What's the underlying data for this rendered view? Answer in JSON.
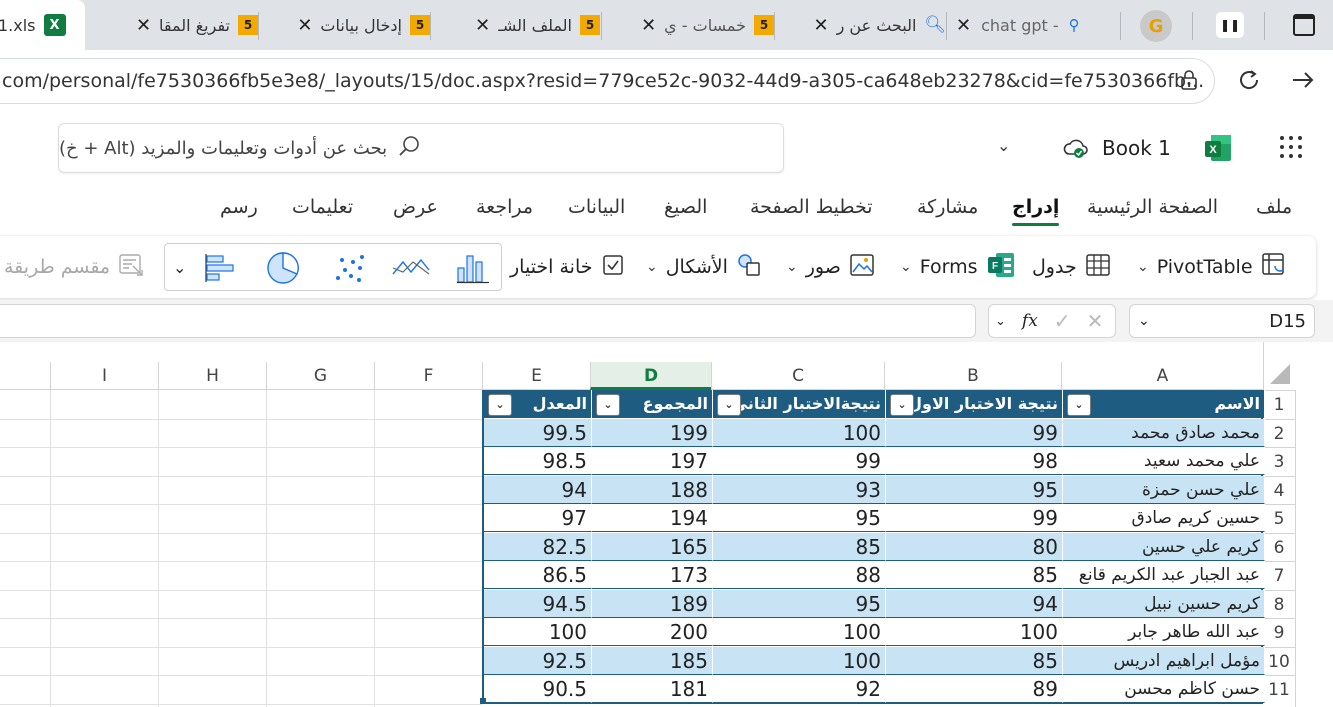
{
  "tabs": [
    {
      "title": "1.xls",
      "icon": "excel-icon"
    },
    {
      "title": "تفريغ المقا",
      "icon": "badge-5-icon"
    },
    {
      "title": "إدخال بيانات",
      "icon": "badge-5-icon"
    },
    {
      "title": "الملف الشـ",
      "icon": "badge-5-icon"
    },
    {
      "title": "خمسات - ي",
      "icon": "badge-5-icon"
    },
    {
      "title": "البحث عن ر",
      "icon": "search-icon"
    },
    {
      "title": "chat gpt -",
      "icon": "chatgpt-icon"
    }
  ],
  "badge_text": "5",
  "address": {
    "url": "com/personal/fe7530366fb5e3e8/_layouts/15/doc.aspx?resid=779ce52c-9032-44d9-a305-ca648eb23278&cid=fe7530366fb..."
  },
  "header": {
    "search_placeholder": "بحث عن أدوات وتعليمات والمزيد (Alt + خ)",
    "doc_title": "Book 1"
  },
  "menu": [
    "ملف",
    "الصفحة الرئيسية",
    "إدراج",
    "مشاركة",
    "تخطيط الصفحة",
    "الصيغ",
    "البيانات",
    "مراجعة",
    "عرض",
    "تعليمات",
    "رسم"
  ],
  "menu_active": "إدراج",
  "ribbon": {
    "pivot": "PivotTable",
    "table": "جدول",
    "forms": "Forms",
    "pictures": "صور",
    "shapes": "الأشكال",
    "checkbox": "خانة اختيار",
    "slicer": "مقسم طريقة"
  },
  "formula": {
    "name_box": "D15",
    "fx": "fx"
  },
  "columns": [
    "A",
    "B",
    "C",
    "D",
    "E",
    "F",
    "G",
    "H",
    "I"
  ],
  "table": {
    "headers": [
      "الاسم",
      "نتيجة الاختبار الاول",
      "نتيجةالاختبار الثاني",
      "المجموع",
      "المعدل"
    ],
    "rows": [
      [
        "محمد صادق محمد",
        "99",
        "100",
        "199",
        "99.5"
      ],
      [
        "علي محمد سعيد",
        "98",
        "99",
        "197",
        "98.5"
      ],
      [
        "علي حسن حمزة",
        "95",
        "93",
        "188",
        "94"
      ],
      [
        "حسين كريم صادق",
        "99",
        "95",
        "194",
        "97"
      ],
      [
        "كريم علي حسين",
        "80",
        "85",
        "165",
        "82.5"
      ],
      [
        "عبد الجبار عبد الكريم قانع",
        "85",
        "88",
        "173",
        "86.5"
      ],
      [
        "كريم حسين نبيل",
        "94",
        "95",
        "189",
        "94.5"
      ],
      [
        "عبد الله طاهر جابر",
        "100",
        "100",
        "200",
        "100"
      ],
      [
        "مؤمل ابراهيم ادريس",
        "85",
        "100",
        "185",
        "92.5"
      ],
      [
        "حسن كاظم محسن",
        "89",
        "92",
        "181",
        "90.5"
      ]
    ]
  },
  "row_numbers": [
    "1",
    "2",
    "3",
    "4",
    "5",
    "6",
    "7",
    "8",
    "9",
    "10",
    "11"
  ],
  "colors": {
    "header_fill": "#1f5c82",
    "band_fill": "#c7e3f4",
    "excel_green": "#107c41"
  }
}
